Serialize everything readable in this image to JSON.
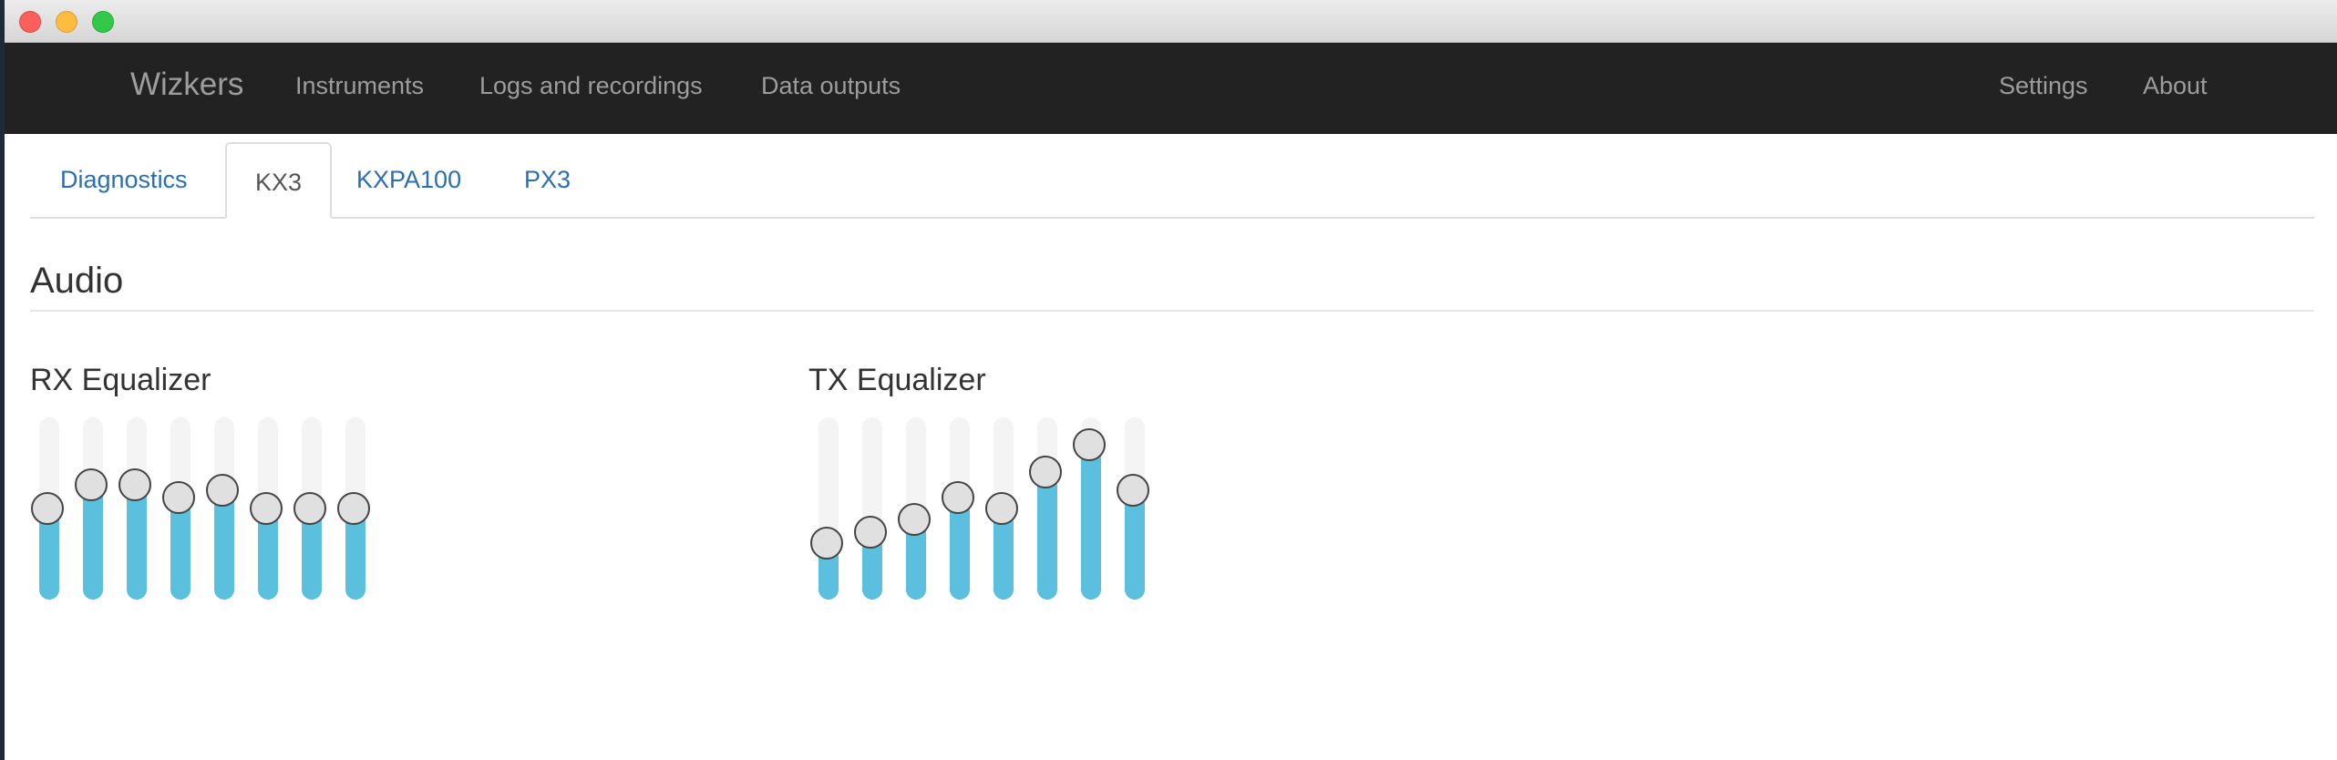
{
  "window": {
    "controls": [
      "close",
      "minimize",
      "zoom"
    ]
  },
  "navbar": {
    "brand": "Wizkers",
    "left_items": [
      "Instruments",
      "Logs and recordings",
      "Data outputs"
    ],
    "right_items": [
      "Settings",
      "About"
    ]
  },
  "tabs": {
    "items": [
      "Diagnostics",
      "KX3",
      "KXPA100",
      "PX3"
    ],
    "active": "KX3"
  },
  "audio": {
    "title": "Audio",
    "rx": {
      "title": "RX Equalizer",
      "levels": [
        0.5,
        0.63,
        0.63,
        0.56,
        0.6,
        0.5,
        0.5,
        0.5
      ]
    },
    "tx": {
      "title": "TX Equalizer",
      "levels": [
        0.31,
        0.37,
        0.44,
        0.56,
        0.5,
        0.7,
        0.85,
        0.6
      ]
    }
  },
  "colors": {
    "slider_fill": "#5bc0de",
    "navbar_bg": "#222222",
    "link": "#2a6fb0"
  }
}
